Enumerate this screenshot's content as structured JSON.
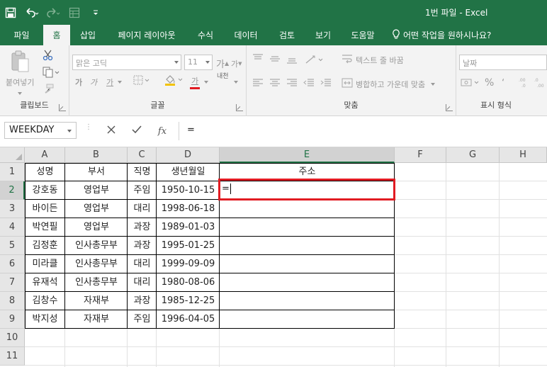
{
  "window": {
    "title": "1번 파일  -  Excel"
  },
  "tabs": [
    {
      "label": "파일"
    },
    {
      "label": "홈"
    },
    {
      "label": "삽입"
    },
    {
      "label": "페이지 레이아웃"
    },
    {
      "label": "수식"
    },
    {
      "label": "데이터"
    },
    {
      "label": "검토"
    },
    {
      "label": "보기"
    },
    {
      "label": "도움말"
    },
    {
      "label": "어떤 작업을 원하시나요?"
    }
  ],
  "ribbon": {
    "clipboard": {
      "label": "클립보드",
      "paste": "붙여넣기"
    },
    "font": {
      "label": "글꼴",
      "name": "맑은 고딕",
      "size": "11",
      "grow": "가",
      "shrink": "가",
      "bold": "가",
      "italic": "가",
      "underline": "가",
      "font_color": "가",
      "phonetic": "내천"
    },
    "alignment": {
      "label": "맞춤",
      "wrap": "텍스트 줄 바꿈",
      "merge": "병합하고 가운데 맞춤"
    },
    "number": {
      "label": "표시 형식",
      "format": "날짜",
      "percent": "%"
    }
  },
  "formula_bar": {
    "name_box": "WEEKDAY",
    "fx": "fx",
    "content": "="
  },
  "sheet": {
    "columns": [
      "A",
      "B",
      "C",
      "D",
      "E",
      "F",
      "G",
      "H"
    ],
    "rows": [
      "1",
      "2",
      "3",
      "4",
      "5",
      "6",
      "7",
      "8",
      "9",
      "10",
      "11"
    ],
    "header": [
      "성명",
      "부서",
      "직명",
      "생년월일",
      "주소"
    ],
    "data": [
      [
        "강호동",
        "영업부",
        "주임",
        "1950-10-15"
      ],
      [
        "바이든",
        "영업부",
        "대리",
        "1998-06-18"
      ],
      [
        "박연필",
        "영업부",
        "과장",
        "1989-01-03"
      ],
      [
        "김정훈",
        "인사총무부",
        "과장",
        "1995-01-25"
      ],
      [
        "미라클",
        "인사총무부",
        "대리",
        "1999-09-09"
      ],
      [
        "유재석",
        "인사총무부",
        "대리",
        "1980-08-06"
      ],
      [
        "김창수",
        "자재부",
        "과장",
        "1985-12-25"
      ],
      [
        "박지성",
        "자재부",
        "주임",
        "1996-04-05"
      ]
    ],
    "editing_value": "=",
    "active_cell": "E2"
  },
  "colors": {
    "brand": "#217346",
    "highlight": "#e11b22"
  }
}
